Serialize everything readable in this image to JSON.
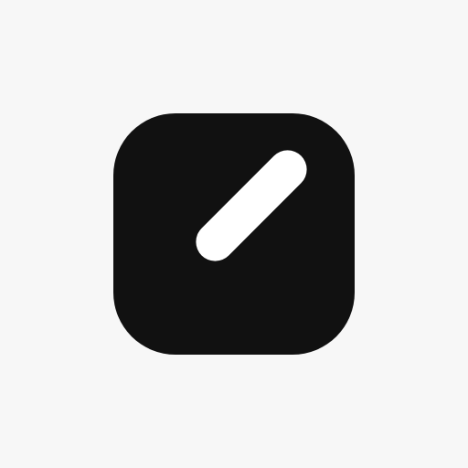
{
  "page": {
    "background_color": "#f7f7f7"
  },
  "icon": {
    "name": "pencil-slash-app-icon",
    "tile_color": "#111111",
    "glyph_color": "#ffffff",
    "glyph_name": "slash-bar-icon"
  }
}
